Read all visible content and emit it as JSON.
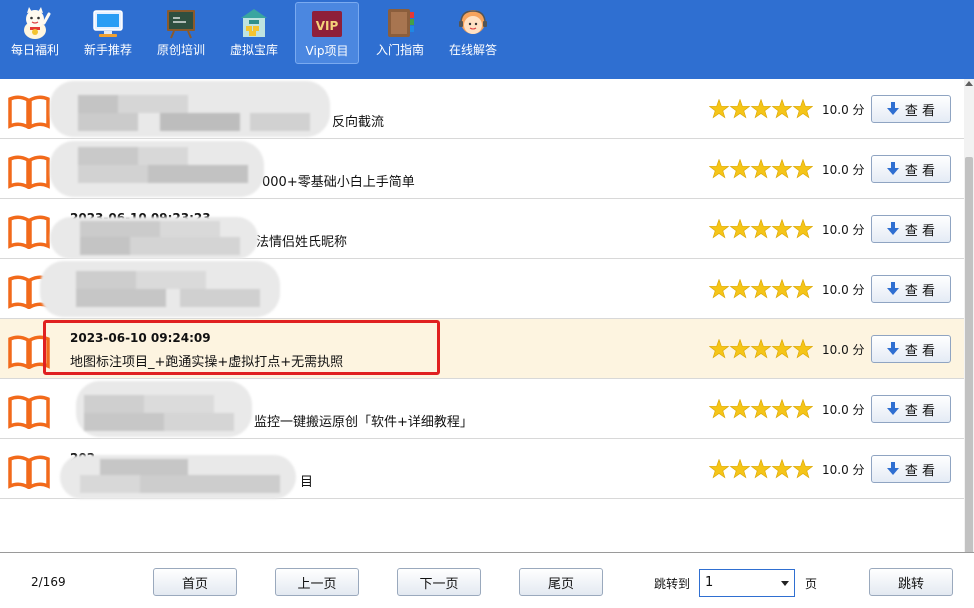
{
  "toolbar": {
    "items": [
      {
        "label": "每日福利",
        "icon": "lucky-cat-icon"
      },
      {
        "label": "新手推荐",
        "icon": "monitor-icon"
      },
      {
        "label": "原创培训",
        "icon": "blackboard-icon"
      },
      {
        "label": "虚拟宝库",
        "icon": "treasure-house-icon"
      },
      {
        "label": "Vip项目",
        "icon": "vip-badge-icon",
        "badge": "VIP",
        "active": true
      },
      {
        "label": "入门指南",
        "icon": "guide-book-icon"
      },
      {
        "label": "在线解答",
        "icon": "support-agent-icon"
      }
    ]
  },
  "colors": {
    "toolbar_bg": "#2f6fd1",
    "star": "#f5c518",
    "book": "#f26a1b",
    "selected_row": "#fdf4e0",
    "highlight": "#e02020"
  },
  "list": {
    "rows": [
      {
        "date": "",
        "title": "反向截流",
        "rating": 5,
        "score": "10.0 分",
        "button": "查 看"
      },
      {
        "date": "",
        "title": "000+零基础小白上手简单",
        "rating": 5,
        "score": "10.0 分",
        "button": "查 看"
      },
      {
        "date": "2023-06-10 09:23:23",
        "title": "法情侣姓氏昵称",
        "rating": 5,
        "score": "10.0 分",
        "button": "查 看"
      },
      {
        "date": "",
        "title": "",
        "rating": 5,
        "score": "10.0 分",
        "button": "查 看"
      },
      {
        "date": "2023-06-10 09:24:09",
        "title": "地图标注项目_+跑通实操+虚拟打点+无需执照",
        "rating": 5,
        "score": "10.0 分",
        "button": "查 看",
        "selected": true
      },
      {
        "date": "",
        "title": "监控一键搬运原创「软件+详细教程」",
        "rating": 5,
        "score": "10.0 分",
        "button": "查 看"
      },
      {
        "date": "202",
        "title": "目",
        "rating": 5,
        "score": "10.0 分",
        "button": "查 看"
      }
    ]
  },
  "pager": {
    "info": "2/169",
    "first": "首页",
    "prev": "上一页",
    "next": "下一页",
    "last": "尾页",
    "jump_label": "跳转到",
    "page_value": "1",
    "page_unit": "页",
    "jump_button": "跳转"
  }
}
